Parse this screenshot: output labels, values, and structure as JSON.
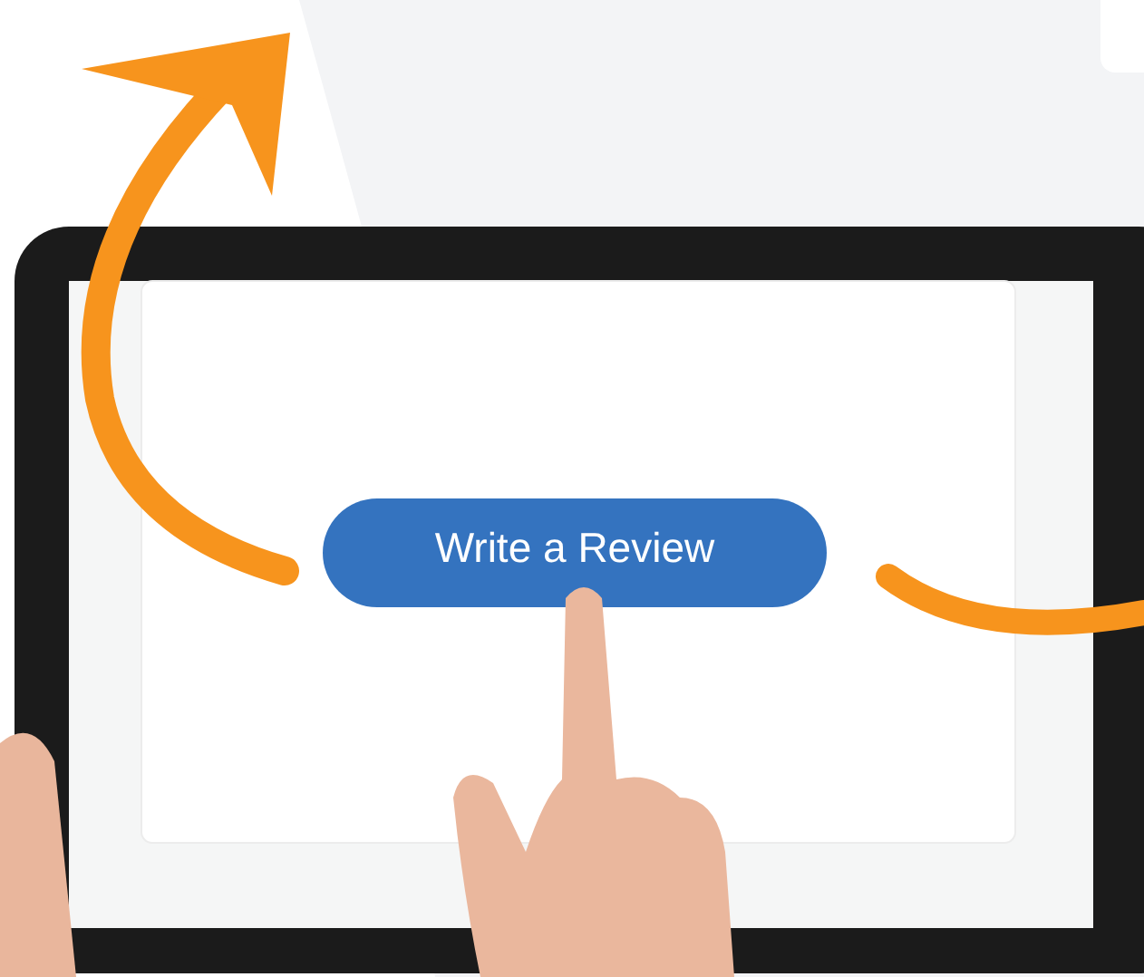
{
  "button": {
    "label": "Write a Review"
  }
}
